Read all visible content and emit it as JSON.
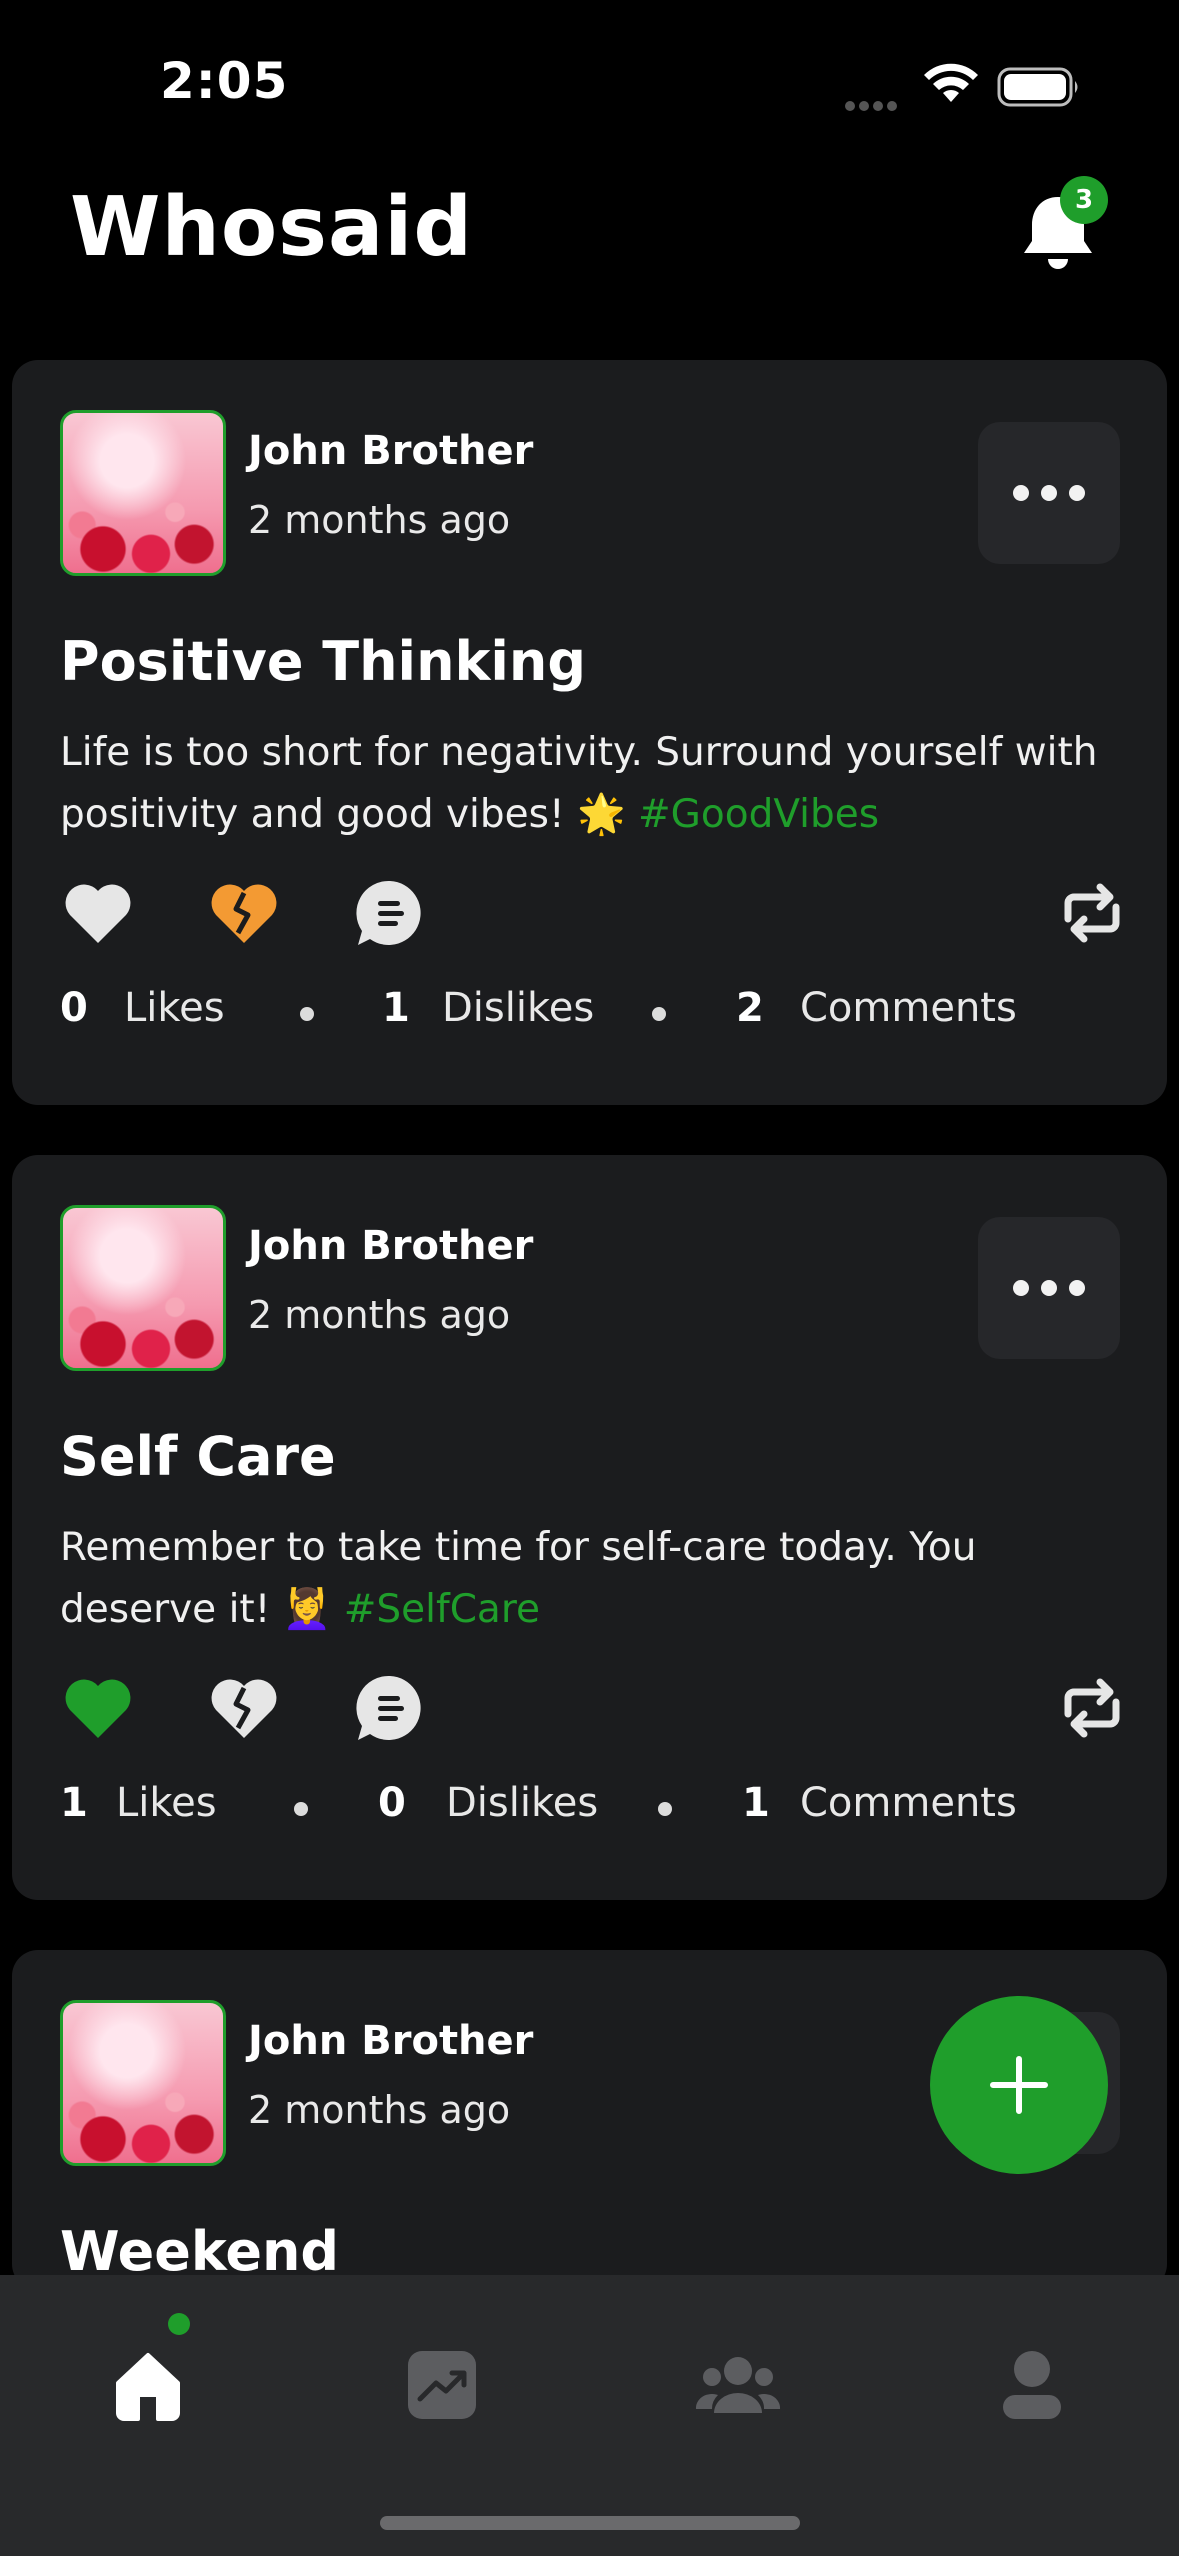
{
  "status_bar": {
    "time": "2:05"
  },
  "header": {
    "title": "Whosaid",
    "notification_count": "3"
  },
  "posts": [
    {
      "author": "John Brother",
      "time_ago": "2 months ago",
      "title": "Positive Thinking",
      "body": "Life is too short for negativity. Surround yourself with positivity and good vibes! 🌟",
      "hashtag": "#GoodVibes",
      "likes": "0",
      "likes_label": "Likes",
      "dislikes": "1",
      "dislikes_label": "Dislikes",
      "comments": "2",
      "comments_label": "Comments",
      "liked": false,
      "disliked": true
    },
    {
      "author": "John Brother",
      "time_ago": "2 months ago",
      "title": "Self Care",
      "body": "Remember to take time for self-care today. You deserve it! 💆‍♀️",
      "hashtag": "#SelfCare",
      "likes": "1",
      "likes_label": "Likes",
      "dislikes": "0",
      "dislikes_label": "Dislikes",
      "comments": "1",
      "comments_label": "Comments",
      "liked": true,
      "disliked": false
    },
    {
      "author": "John Brother",
      "time_ago": "2 months ago",
      "title": "Weekend"
    }
  ],
  "colors": {
    "accent": "#1f9e2b",
    "dislike_active": "#f39a33",
    "card": "#1b1c1e",
    "tab_bar": "#28292b"
  },
  "tabs": [
    {
      "icon": "home-icon",
      "active": true
    },
    {
      "icon": "trending-icon",
      "active": false
    },
    {
      "icon": "group-icon",
      "active": false
    },
    {
      "icon": "profile-icon",
      "active": false
    }
  ]
}
